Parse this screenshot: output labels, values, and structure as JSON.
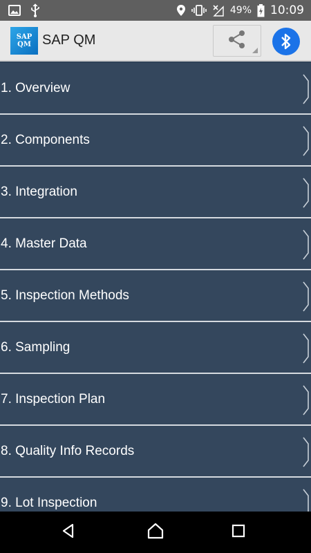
{
  "status_bar": {
    "battery_percent": "49%",
    "time": "10:09",
    "icons": [
      "image-icon",
      "usb-icon",
      "location-icon",
      "vibrate-icon",
      "signal-off-icon",
      "battery-charging-icon"
    ]
  },
  "app_bar": {
    "logo_text_line1": "SAP",
    "logo_text_line2": "QM",
    "title": "SAP QM",
    "share_icon": "share-icon",
    "bluetooth_icon": "bluetooth-icon",
    "accent_color": "#1b73e8"
  },
  "list": {
    "background_color": "#34475d",
    "divider_color": "#d6dbe0",
    "items": [
      {
        "label": "1. Overview"
      },
      {
        "label": "2. Components"
      },
      {
        "label": "3. Integration"
      },
      {
        "label": "4. Master Data"
      },
      {
        "label": "5. Inspection Methods"
      },
      {
        "label": "6. Sampling"
      },
      {
        "label": "7. Inspection Plan"
      },
      {
        "label": "8. Quality Info Records"
      },
      {
        "label": "9. Lot Inspection"
      }
    ]
  },
  "nav_bar": {
    "back_icon": "back-icon",
    "home_icon": "home-icon",
    "recents_icon": "recents-icon"
  }
}
